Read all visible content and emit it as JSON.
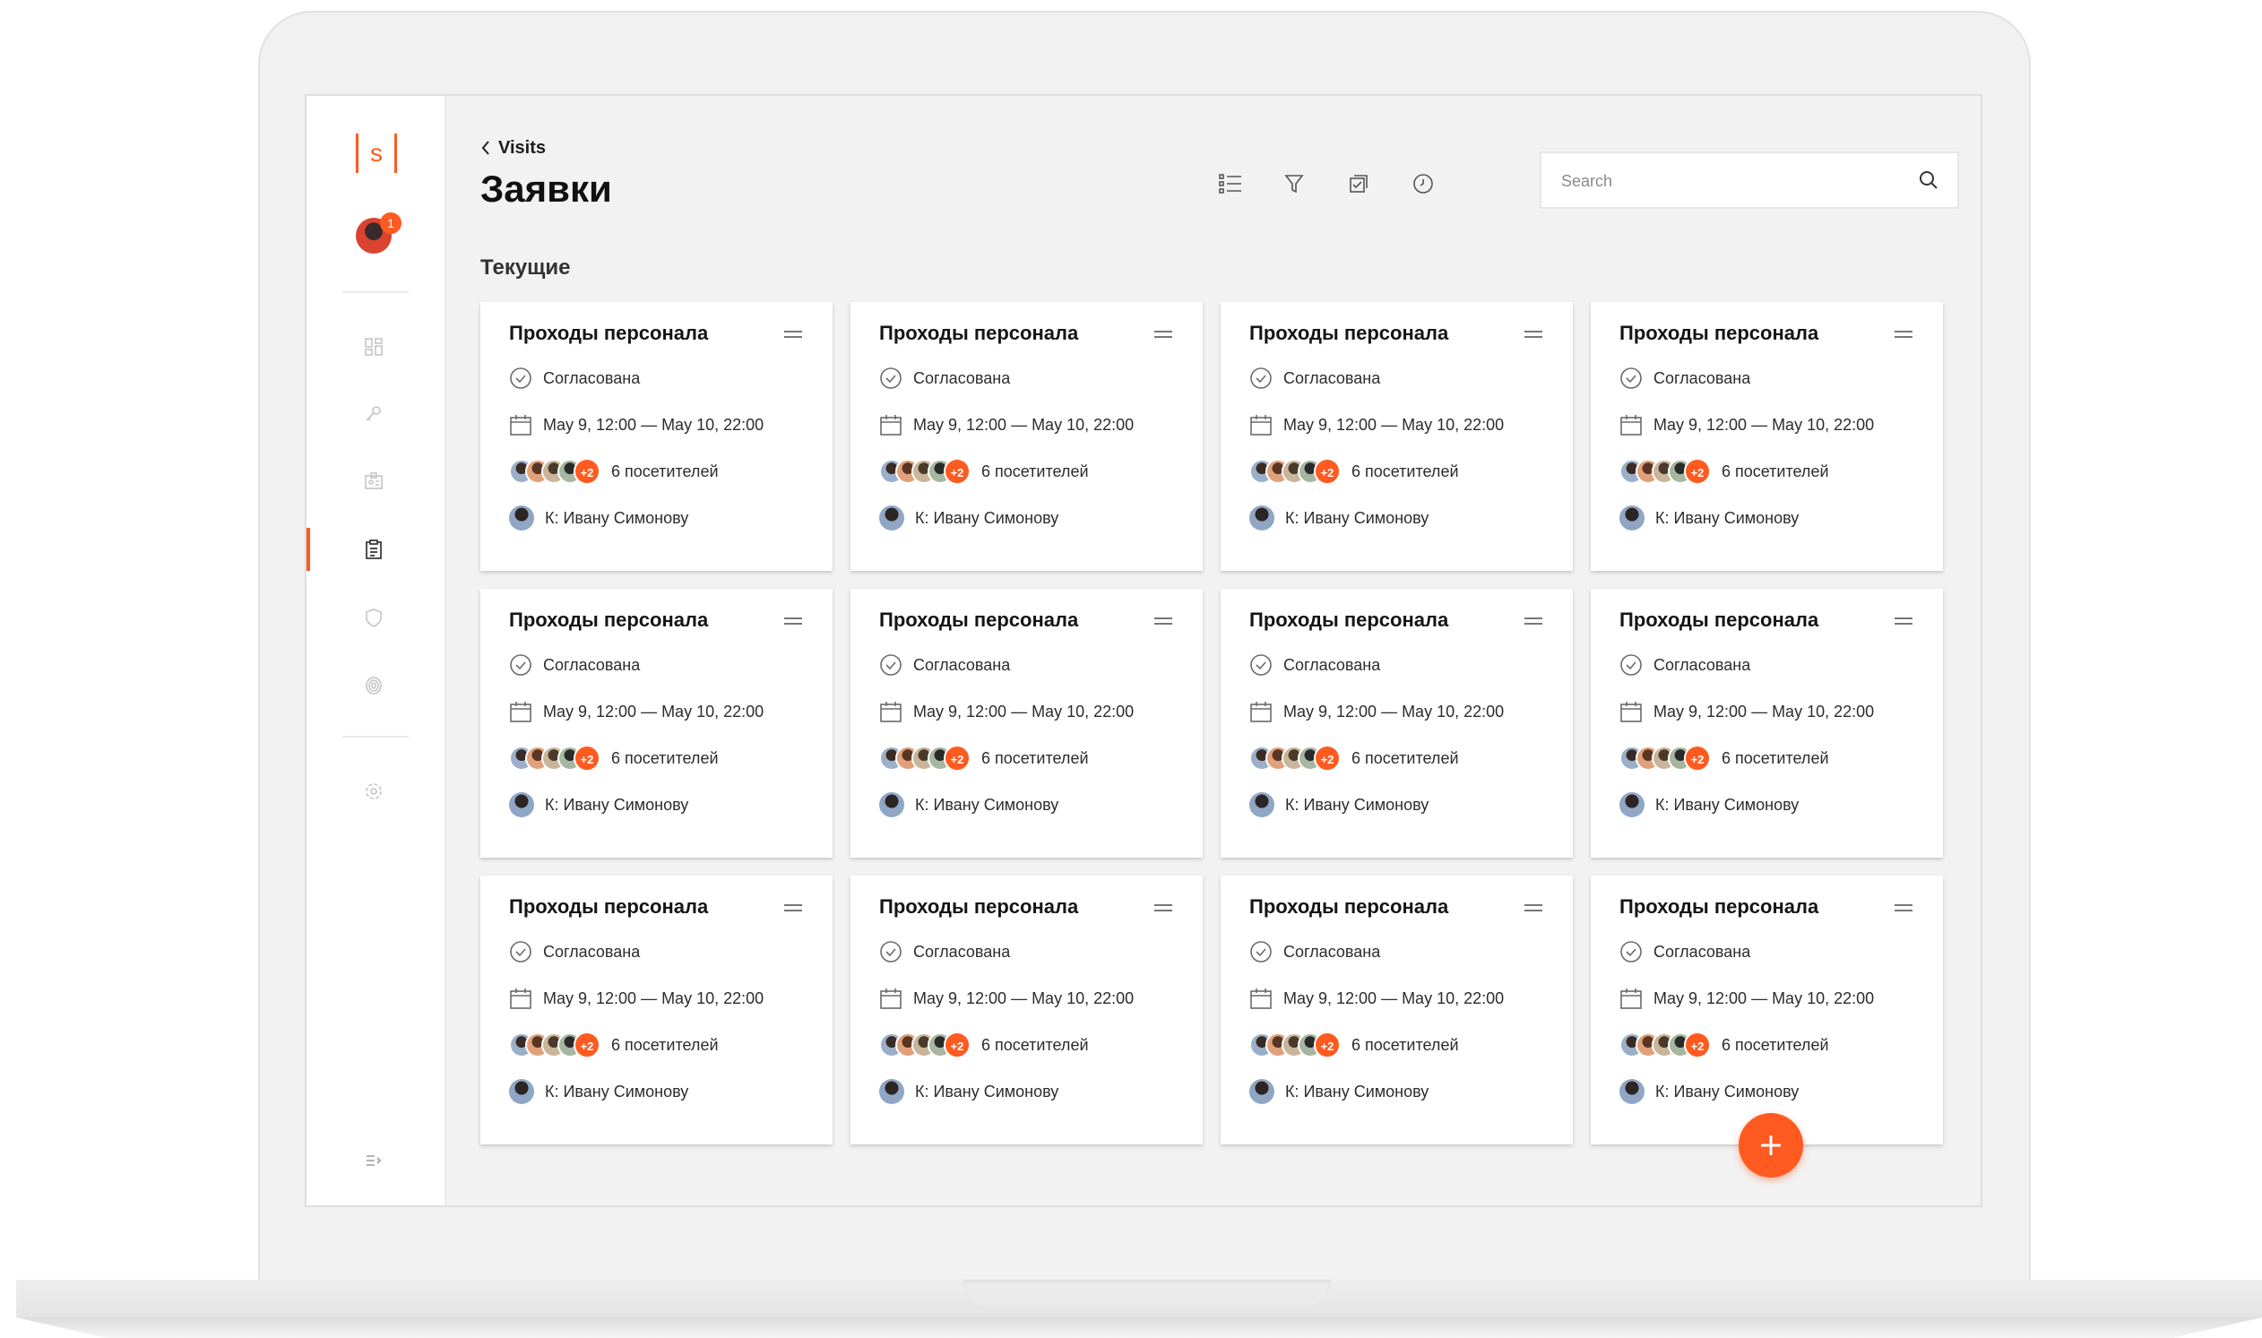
{
  "sidebar": {
    "logo_text": "s",
    "notification_count": "1"
  },
  "header": {
    "back_label": "Visits",
    "title": "Заявки"
  },
  "search": {
    "placeholder": "Search"
  },
  "section_title": "Текущие",
  "cards": [
    {
      "title": "Проходы персонала",
      "status": "Согласована",
      "dates": "May 9, 12:00 — May 10, 22:00",
      "extra_visitors": "+2",
      "visitors": "6 посетителей",
      "host": "К: Ивану Симонову"
    },
    {
      "title": "Проходы персонала",
      "status": "Согласована",
      "dates": "May 9, 12:00 — May 10, 22:00",
      "extra_visitors": "+2",
      "visitors": "6 посетителей",
      "host": "К: Ивану Симонову"
    },
    {
      "title": "Проходы персонала",
      "status": "Согласована",
      "dates": "May 9, 12:00 — May 10, 22:00",
      "extra_visitors": "+2",
      "visitors": "6 посетителей",
      "host": "К: Ивану Симонову"
    },
    {
      "title": "Проходы персонала",
      "status": "Согласована",
      "dates": "May 9, 12:00 — May 10, 22:00",
      "extra_visitors": "+2",
      "visitors": "6 посетителей",
      "host": "К: Ивану Симонову"
    },
    {
      "title": "Проходы персонала",
      "status": "Согласована",
      "dates": "May 9, 12:00 — May 10, 22:00",
      "extra_visitors": "+2",
      "visitors": "6 посетителей",
      "host": "К: Ивану Симонову"
    },
    {
      "title": "Проходы персонала",
      "status": "Согласована",
      "dates": "May 9, 12:00 — May 10, 22:00",
      "extra_visitors": "+2",
      "visitors": "6 посетителей",
      "host": "К: Ивану Симонову"
    },
    {
      "title": "Проходы персонала",
      "status": "Согласована",
      "dates": "May 9, 12:00 — May 10, 22:00",
      "extra_visitors": "+2",
      "visitors": "6 посетителей",
      "host": "К: Ивану Симонову"
    },
    {
      "title": "Проходы персонала",
      "status": "Согласована",
      "dates": "May 9, 12:00 — May 10, 22:00",
      "extra_visitors": "+2",
      "visitors": "6 посетителей",
      "host": "К: Ивану Симонову"
    },
    {
      "title": "Проходы персонала",
      "status": "Согласована",
      "dates": "May 9, 12:00 — May 10, 22:00",
      "extra_visitors": "+2",
      "visitors": "6 посетителей",
      "host": "К: Ивану Симонову"
    },
    {
      "title": "Проходы персонала",
      "status": "Согласована",
      "dates": "May 9, 12:00 — May 10, 22:00",
      "extra_visitors": "+2",
      "visitors": "6 посетителей",
      "host": "К: Ивану Симонову"
    },
    {
      "title": "Проходы персонала",
      "status": "Согласована",
      "dates": "May 9, 12:00 — May 10, 22:00",
      "extra_visitors": "+2",
      "visitors": "6 посетителей",
      "host": "К: Ивану Симонову"
    },
    {
      "title": "Проходы персонала",
      "status": "Согласована",
      "dates": "May 9, 12:00 — May 10, 22:00",
      "extra_visitors": "+2",
      "visitors": "6 посетителей",
      "host": "К: Ивану Симонову"
    }
  ],
  "colors": {
    "accent": "#ff5a1f",
    "background": "#f2f2f2",
    "card": "#ffffff"
  }
}
